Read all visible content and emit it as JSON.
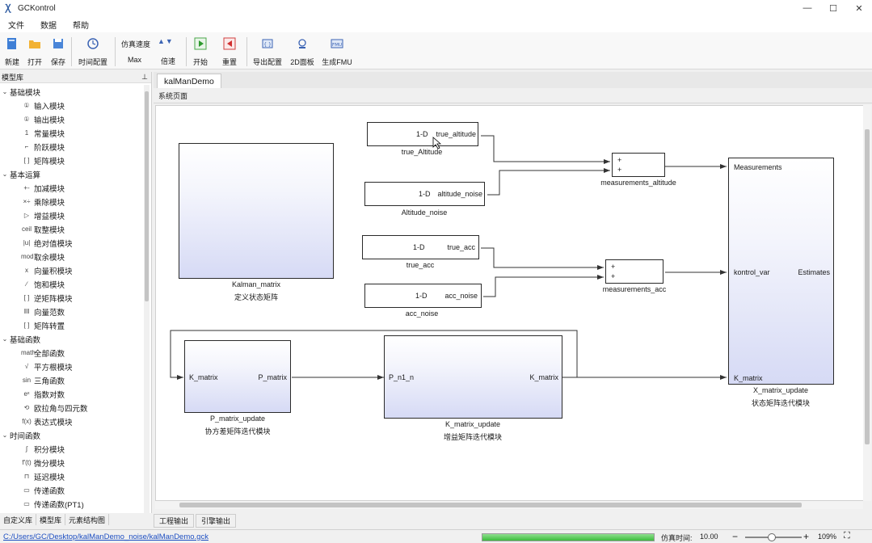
{
  "window": {
    "title": "GCKontrol",
    "controls": [
      "—",
      "☐",
      "✕"
    ]
  },
  "menu": [
    "文件",
    "数据",
    "帮助"
  ],
  "toolbar": {
    "new_label": "新建",
    "open_label": "打开",
    "save_label": "保存",
    "time_config_label": "时间配置",
    "sim_speed_label": "仿真速度",
    "sim_speed_value": "Max",
    "speed_rate_label": "倍速",
    "start_label": "开始",
    "reset_label": "重置",
    "export_config_label": "导出配置",
    "panel2d_label": "2D面板",
    "gen_fmu_label": "生成FMU"
  },
  "model_lib": {
    "title": "模型库",
    "tree": [
      {
        "type": "cat",
        "label": "基础模块"
      },
      {
        "type": "item",
        "icon": "①",
        "label": "输入模块"
      },
      {
        "type": "item",
        "icon": "①",
        "label": "输出模块"
      },
      {
        "type": "item",
        "icon": "1",
        "label": "常量模块"
      },
      {
        "type": "item",
        "icon": "⌐",
        "label": "阶跃模块"
      },
      {
        "type": "item",
        "icon": "[ ]",
        "label": "矩阵模块"
      },
      {
        "type": "cat",
        "label": "基本运算"
      },
      {
        "type": "item",
        "icon": "+-",
        "label": "加减模块"
      },
      {
        "type": "item",
        "icon": "×÷",
        "label": "乘除模块"
      },
      {
        "type": "item",
        "icon": "▷",
        "label": "增益模块"
      },
      {
        "type": "item",
        "icon": "ceil",
        "label": "取整模块"
      },
      {
        "type": "item",
        "icon": "|u|",
        "label": "绝对值模块"
      },
      {
        "type": "item",
        "icon": "mod",
        "label": "取余模块"
      },
      {
        "type": "item",
        "icon": "x",
        "label": "向量积模块"
      },
      {
        "type": "item",
        "icon": "∕",
        "label": "饱和模块"
      },
      {
        "type": "item",
        "icon": "[ ]",
        "label": "逆矩阵模块"
      },
      {
        "type": "item",
        "icon": "‖‖",
        "label": "向量范数"
      },
      {
        "type": "item",
        "icon": "[ ]",
        "label": "矩阵转置"
      },
      {
        "type": "cat",
        "label": "基础函数"
      },
      {
        "type": "item",
        "icon": "math",
        "label": "全部函数"
      },
      {
        "type": "item",
        "icon": "√",
        "label": "平方根模块"
      },
      {
        "type": "item",
        "icon": "sin",
        "label": "三角函数"
      },
      {
        "type": "item",
        "icon": "eˣ",
        "label": "指数对数"
      },
      {
        "type": "item",
        "icon": "⟲",
        "label": "欧拉角与四元数"
      },
      {
        "type": "item",
        "icon": "f(x)",
        "label": "表达式模块"
      },
      {
        "type": "cat",
        "label": "时间函数"
      },
      {
        "type": "item",
        "icon": "∫",
        "label": "积分模块"
      },
      {
        "type": "item",
        "icon": "f'(t)",
        "label": "微分模块"
      },
      {
        "type": "item",
        "icon": "⊓",
        "label": "延迟模块"
      },
      {
        "type": "item",
        "icon": "▭",
        "label": "传递函数"
      },
      {
        "type": "item",
        "icon": "▭",
        "label": "传递函数(PT1)"
      }
    ],
    "bottom_tabs": [
      "自定义库",
      "模型库",
      "元素结构图"
    ]
  },
  "document": {
    "tab_label": "kalManDemo",
    "breadcrumb": "系统页面"
  },
  "blocks": {
    "kalman_matrix": {
      "name": "Kalman_matrix",
      "desc": "定义状态矩阵"
    },
    "true_altitude": {
      "type_text": "1-D",
      "port": "true_altitude",
      "name": "true_Altitude"
    },
    "altitude_noise": {
      "type_text": "1-D",
      "port": "altitude_noise",
      "name": "Altitude_noise"
    },
    "meas_altitude": {
      "in1": "+",
      "in2": "+",
      "name": "measurements_altitude"
    },
    "true_acc": {
      "type_text": "1-D",
      "port": "true_acc",
      "name": "true_acc"
    },
    "acc_noise": {
      "type_text": "1-D",
      "port": "acc_noise",
      "name": "acc_noise"
    },
    "meas_acc": {
      "in1": "+",
      "in2": "+",
      "name": "measurements_acc"
    },
    "x_matrix": {
      "port_meas": "Measurements",
      "port_kv": "kontrol_var",
      "port_est": "Estimates",
      "port_k": "K_matrix",
      "name": "X_matrix_update",
      "desc": "状态矩阵迭代模块"
    },
    "p_matrix": {
      "port_in": "K_matrix",
      "port_out": "P_matrix",
      "name": "P_matrix_update",
      "desc": "协方差矩阵迭代模块"
    },
    "k_matrix": {
      "port_in": "P_n1_n",
      "port_out": "K_matrix",
      "name": "K_matrix_update",
      "desc": "增益矩阵迭代模块"
    }
  },
  "output_tabs": [
    "工程输出",
    "引擎输出"
  ],
  "status": {
    "path": "C:/Users/GC/Desktop/kalManDemo_noise/kalManDemo.gck",
    "progress": 1.0,
    "sim_time_label": "仿真时间:",
    "sim_time_value": "10.00",
    "zoom": "109%"
  }
}
